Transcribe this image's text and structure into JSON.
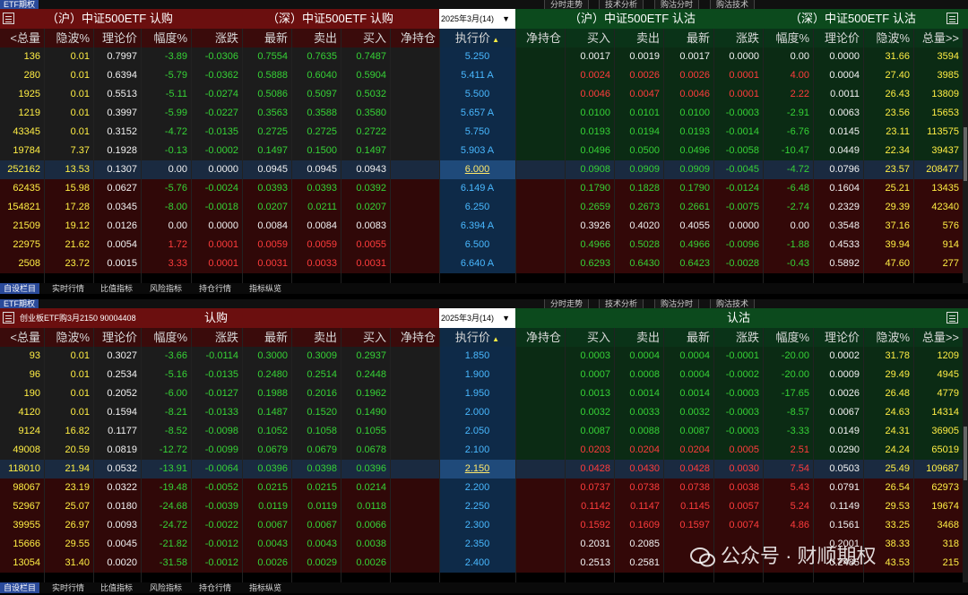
{
  "top": {
    "tab_left": "ETF期权",
    "tabs_right": [
      "分时走势",
      "技术分析",
      "购沽分时",
      "购沽技术"
    ],
    "call_title": "（沪）中证500ETF 认购",
    "call_title2": "（深）中证500ETF 认购",
    "expiry": "2025年3月(14)",
    "put_title": "（沪）中证500ETF 认沽",
    "put_title2": "（深）中证500ETF 认沽",
    "headers_call": [
      "<总量",
      "隐波%",
      "理论价",
      "幅度%",
      "涨跌",
      "最新",
      "卖出",
      "买入",
      "净持仓"
    ],
    "header_strike": "执行价",
    "headers_put": [
      "净持仓",
      "买入",
      "卖出",
      "最新",
      "涨跌",
      "幅度%",
      "理论价",
      "隐波%",
      "总量>>"
    ],
    "rows": [
      [
        "136",
        "0.01",
        "0.7997",
        "-3.89",
        "-0.0306",
        "0.7554",
        "0.7635",
        "0.7487",
        "",
        "5.250",
        "",
        "0.0017",
        "0.0019",
        "0.0017",
        "0.0000",
        "0.00",
        "0.0000",
        "31.66",
        "3594"
      ],
      [
        "280",
        "0.01",
        "0.6394",
        "-5.79",
        "-0.0362",
        "0.5888",
        "0.6040",
        "0.5904",
        "",
        "5.411 A",
        "",
        "0.0024",
        "0.0026",
        "0.0026",
        "0.0001",
        "4.00",
        "0.0004",
        "27.40",
        "3985"
      ],
      [
        "1925",
        "0.01",
        "0.5513",
        "-5.11",
        "-0.0274",
        "0.5086",
        "0.5097",
        "0.5032",
        "",
        "5.500",
        "",
        "0.0046",
        "0.0047",
        "0.0046",
        "0.0001",
        "2.22",
        "0.0011",
        "26.43",
        "13809"
      ],
      [
        "1219",
        "0.01",
        "0.3997",
        "-5.99",
        "-0.0227",
        "0.3563",
        "0.3588",
        "0.3580",
        "",
        "5.657 A",
        "",
        "0.0100",
        "0.0101",
        "0.0100",
        "-0.0003",
        "-2.91",
        "0.0063",
        "23.56",
        "15653"
      ],
      [
        "43345",
        "0.01",
        "0.3152",
        "-4.72",
        "-0.0135",
        "0.2725",
        "0.2725",
        "0.2722",
        "",
        "5.750",
        "",
        "0.0193",
        "0.0194",
        "0.0193",
        "-0.0014",
        "-6.76",
        "0.0145",
        "23.11",
        "113575"
      ],
      [
        "19784",
        "7.37",
        "0.1928",
        "-0.13",
        "-0.0002",
        "0.1497",
        "0.1500",
        "0.1497",
        "",
        "5.903 A",
        "",
        "0.0496",
        "0.0500",
        "0.0496",
        "-0.0058",
        "-10.47",
        "0.0449",
        "22.34",
        "39437"
      ],
      [
        "252162",
        "13.53",
        "0.1307",
        "0.00",
        "0.0000",
        "0.0945",
        "0.0945",
        "0.0943",
        "",
        "6.000",
        "",
        "0.0908",
        "0.0909",
        "0.0909",
        "-0.0045",
        "-4.72",
        "0.0796",
        "23.57",
        "208477"
      ],
      [
        "62435",
        "15.98",
        "0.0627",
        "-5.76",
        "-0.0024",
        "0.0393",
        "0.0393",
        "0.0392",
        "",
        "6.149 A",
        "",
        "0.1790",
        "0.1828",
        "0.1790",
        "-0.0124",
        "-6.48",
        "0.1604",
        "25.21",
        "13435"
      ],
      [
        "154821",
        "17.28",
        "0.0345",
        "-8.00",
        "-0.0018",
        "0.0207",
        "0.0211",
        "0.0207",
        "",
        "6.250",
        "",
        "0.2659",
        "0.2673",
        "0.2661",
        "-0.0075",
        "-2.74",
        "0.2329",
        "29.39",
        "42340"
      ],
      [
        "21509",
        "19.12",
        "0.0126",
        "0.00",
        "0.0000",
        "0.0084",
        "0.0084",
        "0.0083",
        "",
        "6.394 A",
        "",
        "0.3926",
        "0.4020",
        "0.4055",
        "0.0000",
        "0.00",
        "0.3548",
        "37.16",
        "576"
      ],
      [
        "22975",
        "21.62",
        "0.0054",
        "1.72",
        "0.0001",
        "0.0059",
        "0.0059",
        "0.0055",
        "",
        "6.500",
        "",
        "0.4966",
        "0.5028",
        "0.4966",
        "-0.0096",
        "-1.88",
        "0.4533",
        "39.94",
        "914"
      ],
      [
        "2508",
        "23.72",
        "0.0015",
        "3.33",
        "0.0001",
        "0.0031",
        "0.0033",
        "0.0031",
        "",
        "6.640 A",
        "",
        "0.6293",
        "0.6430",
        "0.6423",
        "-0.0028",
        "-0.43",
        "0.5892",
        "47.60",
        "277"
      ]
    ],
    "bottom_tabs": [
      "自设栏目",
      "实时行情",
      "比值指标",
      "风险指标",
      "持仓行情",
      "指标纵览"
    ]
  },
  "bottom": {
    "tab_left": "ETF期权",
    "tabs_right": [
      "分时走势",
      "技术分析",
      "购沽分时",
      "购沽技术"
    ],
    "instrument": "创业板ETF购3月2150  90004408",
    "call_title": "认购",
    "expiry": "2025年3月(14)",
    "put_title": "认沽",
    "headers_call": [
      "<总量",
      "隐波%",
      "理论价",
      "幅度%",
      "涨跌",
      "最新",
      "卖出",
      "买入",
      "净持仓"
    ],
    "header_strike": "执行价",
    "headers_put": [
      "净持仓",
      "买入",
      "卖出",
      "最新",
      "涨跌",
      "幅度%",
      "理论价",
      "隐波%",
      "总量>>"
    ],
    "rows": [
      [
        "93",
        "0.01",
        "0.3027",
        "-3.66",
        "-0.0114",
        "0.3000",
        "0.3009",
        "0.2937",
        "",
        "1.850",
        "",
        "0.0003",
        "0.0004",
        "0.0004",
        "-0.0001",
        "-20.00",
        "0.0002",
        "31.78",
        "1209"
      ],
      [
        "96",
        "0.01",
        "0.2534",
        "-5.16",
        "-0.0135",
        "0.2480",
        "0.2514",
        "0.2448",
        "",
        "1.900",
        "",
        "0.0007",
        "0.0008",
        "0.0004",
        "-0.0002",
        "-20.00",
        "0.0009",
        "29.49",
        "4945"
      ],
      [
        "190",
        "0.01",
        "0.2052",
        "-6.00",
        "-0.0127",
        "0.1988",
        "0.2016",
        "0.1962",
        "",
        "1.950",
        "",
        "0.0013",
        "0.0014",
        "0.0014",
        "-0.0003",
        "-17.65",
        "0.0026",
        "26.48",
        "4779"
      ],
      [
        "4120",
        "0.01",
        "0.1594",
        "-8.21",
        "-0.0133",
        "0.1487",
        "0.1520",
        "0.1490",
        "",
        "2.000",
        "",
        "0.0032",
        "0.0033",
        "0.0032",
        "-0.0003",
        "-8.57",
        "0.0067",
        "24.63",
        "14314"
      ],
      [
        "9124",
        "16.82",
        "0.1177",
        "-8.52",
        "-0.0098",
        "0.1052",
        "0.1058",
        "0.1055",
        "",
        "2.050",
        "",
        "0.0087",
        "0.0088",
        "0.0087",
        "-0.0003",
        "-3.33",
        "0.0149",
        "24.31",
        "36905"
      ],
      [
        "49008",
        "20.59",
        "0.0819",
        "-12.72",
        "-0.0099",
        "0.0679",
        "0.0679",
        "0.0678",
        "",
        "2.100",
        "",
        "0.0203",
        "0.0204",
        "0.0204",
        "0.0005",
        "2.51",
        "0.0290",
        "24.24",
        "65019"
      ],
      [
        "118010",
        "21.94",
        "0.0532",
        "-13.91",
        "-0.0064",
        "0.0396",
        "0.0398",
        "0.0396",
        "",
        "2.150",
        "",
        "0.0428",
        "0.0430",
        "0.0428",
        "0.0030",
        "7.54",
        "0.0503",
        "25.49",
        "109687"
      ],
      [
        "98067",
        "23.19",
        "0.0322",
        "-19.48",
        "-0.0052",
        "0.0215",
        "0.0215",
        "0.0214",
        "",
        "2.200",
        "",
        "0.0737",
        "0.0738",
        "0.0738",
        "0.0038",
        "5.43",
        "0.0791",
        "26.54",
        "62973"
      ],
      [
        "52967",
        "25.07",
        "0.0180",
        "-24.68",
        "-0.0039",
        "0.0119",
        "0.0119",
        "0.0118",
        "",
        "2.250",
        "",
        "0.1142",
        "0.1147",
        "0.1145",
        "0.0057",
        "5.24",
        "0.1149",
        "29.53",
        "19674"
      ],
      [
        "39955",
        "26.97",
        "0.0093",
        "-24.72",
        "-0.0022",
        "0.0067",
        "0.0067",
        "0.0066",
        "",
        "2.300",
        "",
        "0.1592",
        "0.1609",
        "0.1597",
        "0.0074",
        "4.86",
        "0.1561",
        "33.25",
        "3468"
      ],
      [
        "15666",
        "29.55",
        "0.0045",
        "-21.82",
        "-0.0012",
        "0.0043",
        "0.0043",
        "0.0038",
        "",
        "2.350",
        "",
        "0.2031",
        "0.2085",
        "",
        "",
        "",
        "0.2001",
        "38.33",
        "318"
      ],
      [
        "13054",
        "31.40",
        "0.0020",
        "-31.58",
        "-0.0012",
        "0.0026",
        "0.0029",
        "0.0026",
        "",
        "2.400",
        "",
        "0.2513",
        "0.2581",
        "",
        "",
        "",
        "0.2485",
        "43.53",
        "215"
      ]
    ],
    "bottom_tabs": [
      "自设栏目",
      "实时行情",
      "比值指标",
      "风险指标",
      "持仓行情",
      "指标纵览"
    ]
  },
  "watermark": "公众号 · 财顺期权"
}
